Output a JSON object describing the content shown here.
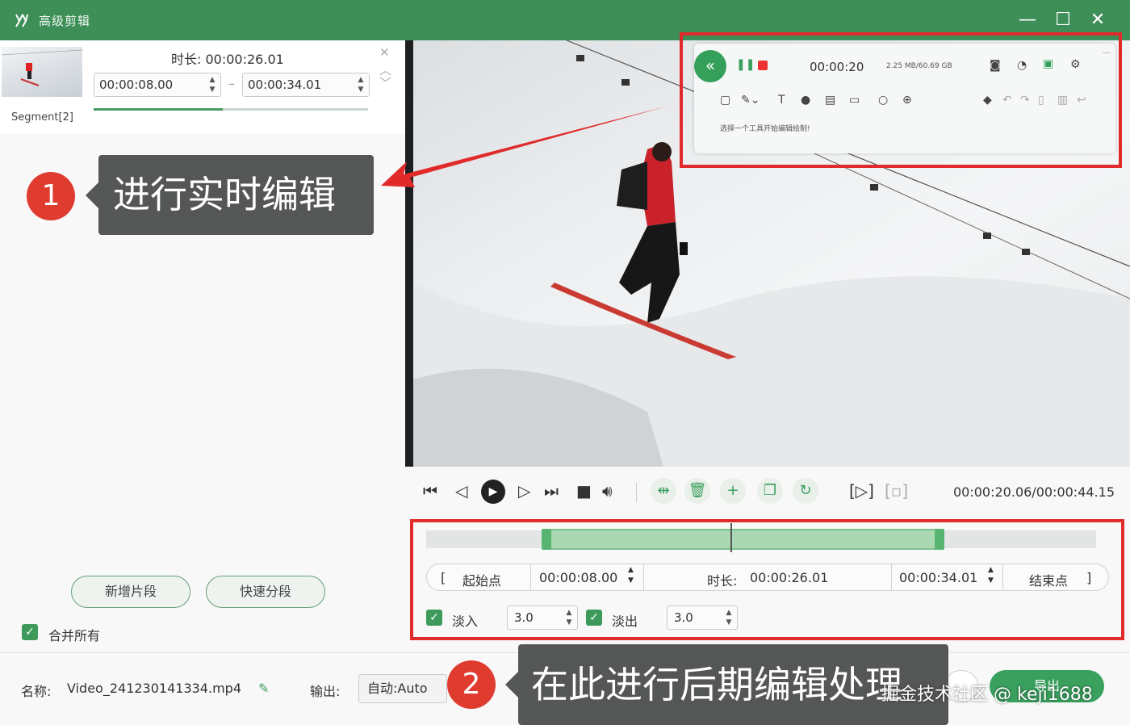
{
  "app": {
    "title": "高级剪辑",
    "window_controls": {
      "minimize": "—",
      "maximize": "☐",
      "close": "✕"
    }
  },
  "segment": {
    "label": "Segment[2]",
    "duration_label": "时长:",
    "duration": "00:00:26.01",
    "start": "00:00:08.00",
    "dash": "–",
    "end": "00:00:34.01",
    "progress": 0.47
  },
  "callouts": {
    "one": {
      "number": "1",
      "text": "进行实时编辑"
    },
    "two": {
      "number": "2",
      "text": "在此进行后期编辑处理"
    }
  },
  "left_buttons": {
    "add_segment": "新增片段",
    "quick_split": "快速分段",
    "merge_all": "合并所有"
  },
  "recorder": {
    "time": "00:00:20",
    "size_info": "2.25 MB/60.69 GB",
    "hint": "选择一个工具开始编辑绘制!"
  },
  "player": {
    "timecode": "00:00:20.06/00:00:44.15"
  },
  "editor": {
    "start_label": "起始点",
    "start_time": "00:00:08.00",
    "duration_label": "时长:",
    "duration": "00:00:26.01",
    "end_time": "00:00:34.01",
    "end_label": "结束点",
    "fade_in_label": "淡入",
    "fade_in_value": "3.0",
    "fade_out_label": "淡出",
    "fade_out_value": "3.0"
  },
  "bottom": {
    "name_label": "名称:",
    "file_name": "Video_241230141334.mp4",
    "output_label": "输出:",
    "output_value": "自动:Auto",
    "export_label": "导出"
  },
  "watermark": "掘金技术社区 @ keji1688",
  "colors": {
    "accent": "#3e8e58",
    "highlight": "#e12a2a",
    "callout": "#555756"
  }
}
